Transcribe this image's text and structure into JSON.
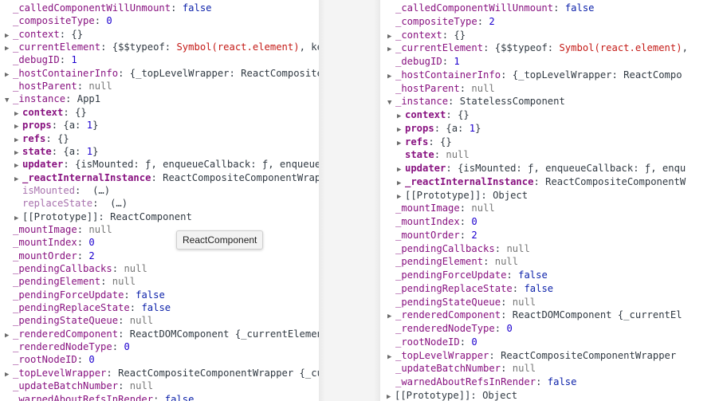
{
  "left_panel": [
    {
      "indent": 0,
      "toggle": "none",
      "key": "_calledComponentWillUnmount",
      "sep": ": ",
      "parts": [
        {
          "t": "false",
          "c": "kw"
        }
      ]
    },
    {
      "indent": 0,
      "toggle": "none",
      "key": "_compositeType",
      "sep": ": ",
      "parts": [
        {
          "t": "0",
          "c": "num"
        }
      ]
    },
    {
      "indent": 0,
      "toggle": "collapsed",
      "key": "_context",
      "sep": ": ",
      "parts": [
        {
          "t": "{}",
          "c": "v"
        }
      ]
    },
    {
      "indent": 0,
      "toggle": "collapsed",
      "key": "_currentElement",
      "sep": ": ",
      "parts": [
        {
          "t": "{$$typeof: ",
          "c": "v"
        },
        {
          "t": "Symbol(react.element)",
          "c": "str"
        },
        {
          "t": ", ke",
          "c": "v"
        }
      ]
    },
    {
      "indent": 0,
      "toggle": "none",
      "key": "_debugID",
      "sep": ": ",
      "parts": [
        {
          "t": "1",
          "c": "num"
        }
      ]
    },
    {
      "indent": 0,
      "toggle": "collapsed",
      "key": "_hostContainerInfo",
      "sep": ": ",
      "parts": [
        {
          "t": "{_topLevelWrapper: ReactComposite",
          "c": "v"
        }
      ]
    },
    {
      "indent": 0,
      "toggle": "none",
      "key": "_hostParent",
      "sep": ": ",
      "parts": [
        {
          "t": "null",
          "c": "gray"
        }
      ]
    },
    {
      "indent": 0,
      "toggle": "expanded",
      "key": "_instance",
      "sep": ": ",
      "parts": [
        {
          "t": "App1",
          "c": "v"
        }
      ]
    },
    {
      "indent": 1,
      "toggle": "collapsed",
      "key": "context",
      "sep": ": ",
      "kstyle": "bold",
      "parts": [
        {
          "t": "{}",
          "c": "v"
        }
      ]
    },
    {
      "indent": 1,
      "toggle": "collapsed",
      "key": "props",
      "sep": ": ",
      "kstyle": "bold",
      "parts": [
        {
          "t": "{a: ",
          "c": "v"
        },
        {
          "t": "1",
          "c": "num"
        },
        {
          "t": "}",
          "c": "v"
        }
      ]
    },
    {
      "indent": 1,
      "toggle": "collapsed",
      "key": "refs",
      "sep": ": ",
      "kstyle": "bold",
      "parts": [
        {
          "t": "{}",
          "c": "v"
        }
      ]
    },
    {
      "indent": 1,
      "toggle": "collapsed",
      "key": "state",
      "sep": ": ",
      "kstyle": "bold",
      "parts": [
        {
          "t": "{a: ",
          "c": "v"
        },
        {
          "t": "1",
          "c": "num"
        },
        {
          "t": "}",
          "c": "v"
        }
      ]
    },
    {
      "indent": 1,
      "toggle": "collapsed",
      "key": "updater",
      "sep": ": ",
      "kstyle": "bold",
      "parts": [
        {
          "t": "{isMounted: ",
          "c": "v"
        },
        {
          "t": "ƒ",
          "c": "v"
        },
        {
          "t": ", enqueueCallback: ",
          "c": "v"
        },
        {
          "t": "ƒ",
          "c": "v"
        },
        {
          "t": ", enqueue",
          "c": "v"
        }
      ]
    },
    {
      "indent": 1,
      "toggle": "collapsed",
      "key": "_reactInternalInstance",
      "sep": ": ",
      "kstyle": "bold",
      "parts": [
        {
          "t": "ReactCompositeComponentWrap",
          "c": "v"
        }
      ]
    },
    {
      "indent": 1,
      "toggle": "none",
      "key": "isMounted",
      "sep": ":  ",
      "kstyle": "dim",
      "parts": [
        {
          "t": "(…)",
          "c": "v"
        }
      ]
    },
    {
      "indent": 1,
      "toggle": "none",
      "key": "replaceState",
      "sep": ":  ",
      "kstyle": "dim",
      "parts": [
        {
          "t": "(…)",
          "c": "v"
        }
      ]
    },
    {
      "indent": 1,
      "toggle": "collapsed",
      "key": "[[Prototype]]",
      "sep": ": ",
      "kstyle": "plain",
      "parts": [
        {
          "t": "ReactComponent",
          "c": "v"
        }
      ]
    },
    {
      "indent": 0,
      "toggle": "none",
      "key": "_mountImage",
      "sep": ": ",
      "parts": [
        {
          "t": "null",
          "c": "gray"
        }
      ]
    },
    {
      "indent": 0,
      "toggle": "none",
      "key": "_mountIndex",
      "sep": ": ",
      "parts": [
        {
          "t": "0",
          "c": "num"
        }
      ]
    },
    {
      "indent": 0,
      "toggle": "none",
      "key": "_mountOrder",
      "sep": ": ",
      "parts": [
        {
          "t": "2",
          "c": "num"
        }
      ]
    },
    {
      "indent": 0,
      "toggle": "none",
      "key": "_pendingCallbacks",
      "sep": ": ",
      "parts": [
        {
          "t": "null",
          "c": "gray"
        }
      ]
    },
    {
      "indent": 0,
      "toggle": "none",
      "key": "_pendingElement",
      "sep": ": ",
      "parts": [
        {
          "t": "null",
          "c": "gray"
        }
      ]
    },
    {
      "indent": 0,
      "toggle": "none",
      "key": "_pendingForceUpdate",
      "sep": ": ",
      "parts": [
        {
          "t": "false",
          "c": "kw"
        }
      ]
    },
    {
      "indent": 0,
      "toggle": "none",
      "key": "_pendingReplaceState",
      "sep": ": ",
      "parts": [
        {
          "t": "false",
          "c": "kw"
        }
      ]
    },
    {
      "indent": 0,
      "toggle": "none",
      "key": "_pendingStateQueue",
      "sep": ": ",
      "parts": [
        {
          "t": "null",
          "c": "gray"
        }
      ]
    },
    {
      "indent": 0,
      "toggle": "collapsed",
      "key": "_renderedComponent",
      "sep": ": ",
      "parts": [
        {
          "t": "ReactDOMComponent {_currentElemen",
          "c": "v"
        }
      ]
    },
    {
      "indent": 0,
      "toggle": "none",
      "key": "_renderedNodeType",
      "sep": ": ",
      "parts": [
        {
          "t": "0",
          "c": "num"
        }
      ]
    },
    {
      "indent": 0,
      "toggle": "none",
      "key": "_rootNodeID",
      "sep": ": ",
      "parts": [
        {
          "t": "0",
          "c": "num"
        }
      ]
    },
    {
      "indent": 0,
      "toggle": "collapsed",
      "key": "_topLevelWrapper",
      "sep": ": ",
      "parts": [
        {
          "t": "ReactCompositeComponentWrapper {_cu",
          "c": "v"
        }
      ]
    },
    {
      "indent": 0,
      "toggle": "none",
      "key": "_updateBatchNumber",
      "sep": ": ",
      "parts": [
        {
          "t": "null",
          "c": "gray"
        }
      ]
    },
    {
      "indent": 0,
      "toggle": "none",
      "key": "_warnedAboutRefsInRender",
      "sep": ": ",
      "parts": [
        {
          "t": "false",
          "c": "kw"
        }
      ]
    }
  ],
  "right_panel": [
    {
      "indent": 0,
      "toggle": "none",
      "key": "_calledComponentWillUnmount",
      "sep": ": ",
      "parts": [
        {
          "t": "false",
          "c": "kw"
        }
      ]
    },
    {
      "indent": 0,
      "toggle": "none",
      "key": "_compositeType",
      "sep": ": ",
      "parts": [
        {
          "t": "2",
          "c": "num"
        }
      ]
    },
    {
      "indent": 0,
      "toggle": "collapsed",
      "key": "_context",
      "sep": ": ",
      "parts": [
        {
          "t": "{}",
          "c": "v"
        }
      ]
    },
    {
      "indent": 0,
      "toggle": "collapsed",
      "key": "_currentElement",
      "sep": ": ",
      "parts": [
        {
          "t": "{$$typeof: ",
          "c": "v"
        },
        {
          "t": "Symbol(react.element)",
          "c": "str"
        },
        {
          "t": ",",
          "c": "v"
        }
      ]
    },
    {
      "indent": 0,
      "toggle": "none",
      "key": "_debugID",
      "sep": ": ",
      "parts": [
        {
          "t": "1",
          "c": "num"
        }
      ]
    },
    {
      "indent": 0,
      "toggle": "collapsed",
      "key": "_hostContainerInfo",
      "sep": ": ",
      "parts": [
        {
          "t": "{_topLevelWrapper: ReactCompo",
          "c": "v"
        }
      ]
    },
    {
      "indent": 0,
      "toggle": "none",
      "key": "_hostParent",
      "sep": ": ",
      "parts": [
        {
          "t": "null",
          "c": "gray"
        }
      ]
    },
    {
      "indent": 0,
      "toggle": "expanded",
      "key": "_instance",
      "sep": ": ",
      "parts": [
        {
          "t": "StatelessComponent",
          "c": "v"
        }
      ]
    },
    {
      "indent": 1,
      "toggle": "collapsed",
      "key": "context",
      "sep": ": ",
      "kstyle": "bold",
      "parts": [
        {
          "t": "{}",
          "c": "v"
        }
      ]
    },
    {
      "indent": 1,
      "toggle": "collapsed",
      "key": "props",
      "sep": ": ",
      "kstyle": "bold",
      "parts": [
        {
          "t": "{a: ",
          "c": "v"
        },
        {
          "t": "1",
          "c": "num"
        },
        {
          "t": "}",
          "c": "v"
        }
      ]
    },
    {
      "indent": 1,
      "toggle": "collapsed",
      "key": "refs",
      "sep": ": ",
      "kstyle": "bold",
      "parts": [
        {
          "t": "{}",
          "c": "v"
        }
      ]
    },
    {
      "indent": 1,
      "toggle": "none",
      "key": "state",
      "sep": ": ",
      "kstyle": "bold",
      "parts": [
        {
          "t": "null",
          "c": "gray"
        }
      ]
    },
    {
      "indent": 1,
      "toggle": "collapsed",
      "key": "updater",
      "sep": ": ",
      "kstyle": "bold",
      "parts": [
        {
          "t": "{isMounted: ",
          "c": "v"
        },
        {
          "t": "ƒ",
          "c": "v"
        },
        {
          "t": ", enqueueCallback: ",
          "c": "v"
        },
        {
          "t": "ƒ",
          "c": "v"
        },
        {
          "t": ", enqu",
          "c": "v"
        }
      ]
    },
    {
      "indent": 1,
      "toggle": "collapsed",
      "key": "_reactInternalInstance",
      "sep": ": ",
      "kstyle": "bold",
      "parts": [
        {
          "t": "ReactCompositeComponentW",
          "c": "v"
        }
      ]
    },
    {
      "indent": 1,
      "toggle": "collapsed",
      "key": "[[Prototype]]",
      "sep": ": ",
      "kstyle": "plain",
      "parts": [
        {
          "t": "Object",
          "c": "v"
        }
      ]
    },
    {
      "indent": 0,
      "toggle": "none",
      "key": "_mountImage",
      "sep": ": ",
      "parts": [
        {
          "t": "null",
          "c": "gray"
        }
      ]
    },
    {
      "indent": 0,
      "toggle": "none",
      "key": "_mountIndex",
      "sep": ": ",
      "parts": [
        {
          "t": "0",
          "c": "num"
        }
      ]
    },
    {
      "indent": 0,
      "toggle": "none",
      "key": "_mountOrder",
      "sep": ": ",
      "parts": [
        {
          "t": "2",
          "c": "num"
        }
      ]
    },
    {
      "indent": 0,
      "toggle": "none",
      "key": "_pendingCallbacks",
      "sep": ": ",
      "parts": [
        {
          "t": "null",
          "c": "gray"
        }
      ]
    },
    {
      "indent": 0,
      "toggle": "none",
      "key": "_pendingElement",
      "sep": ": ",
      "parts": [
        {
          "t": "null",
          "c": "gray"
        }
      ]
    },
    {
      "indent": 0,
      "toggle": "none",
      "key": "_pendingForceUpdate",
      "sep": ": ",
      "parts": [
        {
          "t": "false",
          "c": "kw"
        }
      ]
    },
    {
      "indent": 0,
      "toggle": "none",
      "key": "_pendingReplaceState",
      "sep": ": ",
      "parts": [
        {
          "t": "false",
          "c": "kw"
        }
      ]
    },
    {
      "indent": 0,
      "toggle": "none",
      "key": "_pendingStateQueue",
      "sep": ": ",
      "parts": [
        {
          "t": "null",
          "c": "gray"
        }
      ]
    },
    {
      "indent": 0,
      "toggle": "collapsed",
      "key": "_renderedComponent",
      "sep": ": ",
      "parts": [
        {
          "t": "ReactDOMComponent {_currentEl",
          "c": "v"
        }
      ]
    },
    {
      "indent": 0,
      "toggle": "none",
      "key": "_renderedNodeType",
      "sep": ": ",
      "parts": [
        {
          "t": "0",
          "c": "num"
        }
      ]
    },
    {
      "indent": 0,
      "toggle": "none",
      "key": "_rootNodeID",
      "sep": ": ",
      "parts": [
        {
          "t": "0",
          "c": "num"
        }
      ]
    },
    {
      "indent": 0,
      "toggle": "collapsed",
      "key": "_topLevelWrapper",
      "sep": ": ",
      "parts": [
        {
          "t": "ReactCompositeComponentWrapper",
          "c": "v"
        }
      ]
    },
    {
      "indent": 0,
      "toggle": "none",
      "key": "_updateBatchNumber",
      "sep": ": ",
      "parts": [
        {
          "t": "null",
          "c": "gray"
        }
      ]
    },
    {
      "indent": 0,
      "toggle": "none",
      "key": "_warnedAboutRefsInRender",
      "sep": ": ",
      "parts": [
        {
          "t": "false",
          "c": "kw"
        }
      ]
    },
    {
      "indent": -1,
      "toggle": "collapsed",
      "key": "[[Prototype]]",
      "sep": ": ",
      "kstyle": "plain",
      "parts": [
        {
          "t": "Object",
          "c": "v"
        }
      ]
    }
  ],
  "tooltip": {
    "text": "ReactComponent"
  },
  "colors": {
    "key": "#881280",
    "number": "#1c00cf",
    "keyword": "#0d22aa",
    "string": "#c41a16",
    "null": "#777777"
  }
}
